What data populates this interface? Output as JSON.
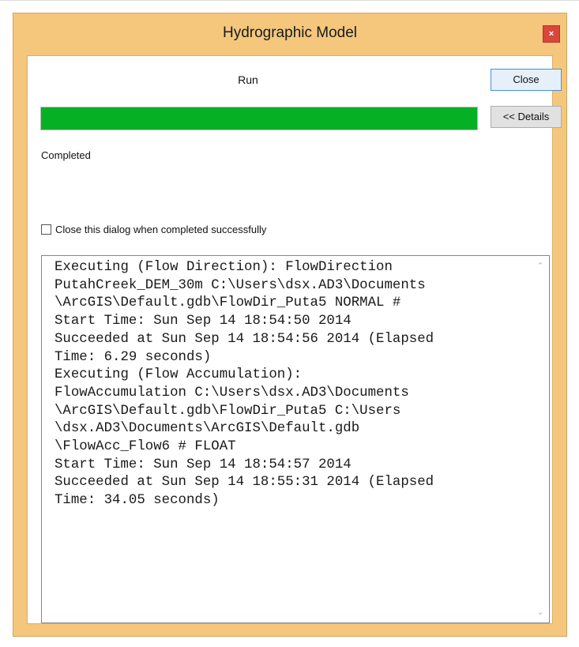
{
  "window": {
    "title": "Hydrographic Model",
    "close_glyph": "×"
  },
  "run": {
    "label": "Run",
    "progress": 1.0
  },
  "buttons": {
    "close_label": "Close",
    "details_label": "<< Details"
  },
  "status": {
    "text": "Completed"
  },
  "option": {
    "label": "Close this dialog when completed successfully",
    "checked": false
  },
  "log": {
    "lines": [
      "Executing (Flow Direction): FlowDirection",
      "PutahCreek_DEM_30m C:\\Users\\dsx.AD3\\Documents",
      "\\ArcGIS\\Default.gdb\\FlowDir_Puta5 NORMAL #",
      "Start Time: Sun Sep 14 18:54:50 2014",
      "Succeeded at Sun Sep 14 18:54:56 2014 (Elapsed",
      "Time: 6.29 seconds)",
      "Executing (Flow Accumulation):",
      "FlowAccumulation C:\\Users\\dsx.AD3\\Documents",
      "\\ArcGIS\\Default.gdb\\FlowDir_Puta5 C:\\Users",
      "\\dsx.AD3\\Documents\\ArcGIS\\Default.gdb",
      "\\FlowAcc_Flow6 # FLOAT",
      "Start Time: Sun Sep 14 18:54:57 2014",
      "Succeeded at Sun Sep 14 18:55:31 2014 (Elapsed",
      "Time: 34.05 seconds)"
    ]
  },
  "colors": {
    "titlebar": "#f4c77d",
    "progress_fill": "#06b025",
    "close_x": "#d9473a"
  }
}
